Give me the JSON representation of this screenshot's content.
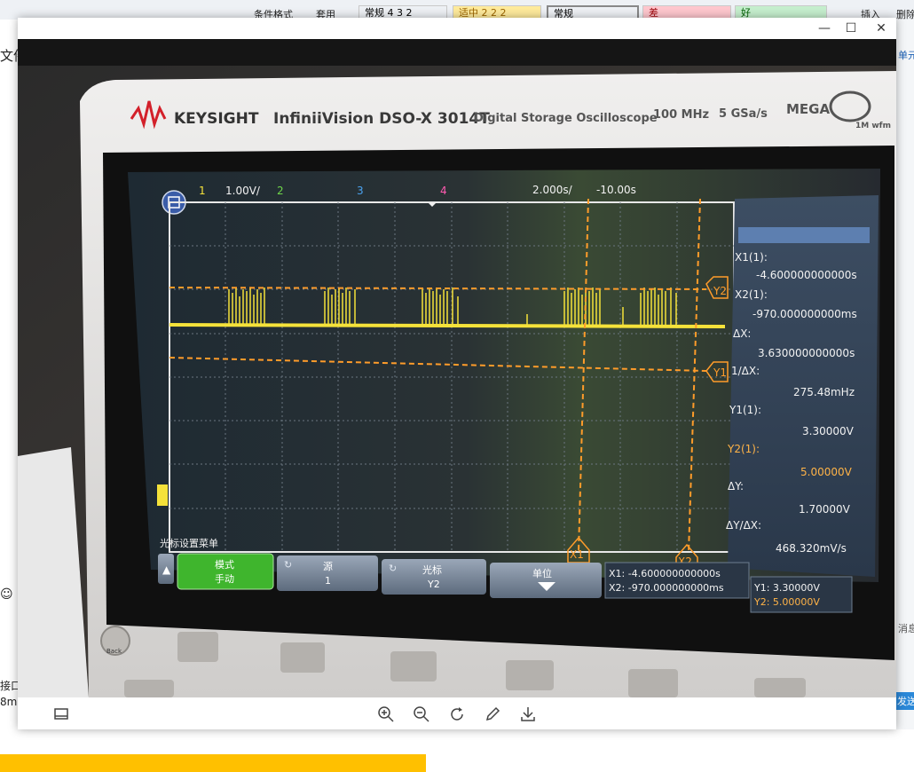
{
  "window": {
    "minimize_label": "—",
    "maximize_label": "☐",
    "close_label": "✕"
  },
  "background_app": {
    "ribbon_text_1": "条件格式",
    "ribbon_text_2": "套用",
    "style_cells": [
      {
        "label": "常规 4 3 2",
        "bg": "#ffffff"
      },
      {
        "label": "适中 2 2 2",
        "bg": "#ffeb9c"
      },
      {
        "label": "常规",
        "bg": "#ffffff"
      },
      {
        "label": "差",
        "bg": "#ffc7ce"
      },
      {
        "label": "好",
        "bg": "#c6efce"
      }
    ],
    "right_text_1": "插入",
    "right_text_2": "删除",
    "right_text_3": "单元",
    "right_msg": "消息",
    "right_send": "发送",
    "left_text_1": "文件",
    "left_text_2": "接口",
    "left_text_3": "8m"
  },
  "scope": {
    "brand": "KEYSIGHT",
    "model": "InfiniiVision DSO-X 3014T",
    "description": "Digital Storage Oscilloscope",
    "bandwidth": "100 MHz",
    "sample_rate": "5 GSa/s",
    "megazoom": "MEGA",
    "megazoom_sub": "1M wfm",
    "ch1_label": "1",
    "ch1_scale": "1.00V/",
    "ch2_label": "2",
    "ch3_label": "3",
    "ch4_label": "4",
    "time_scale": "2.000s/",
    "time_offset": "-10.00s",
    "cursor_labels": {
      "y1": "Y1",
      "y2": "Y2",
      "x1": "X1",
      "x2": "X2"
    },
    "panel": [
      {
        "label": "X1(1):",
        "value": "-4.600000000000s"
      },
      {
        "label": "X2(1):",
        "value": "-970.000000000ms"
      },
      {
        "label": "ΔX:",
        "value": "3.630000000000s"
      },
      {
        "label": "1/ΔX:",
        "value": "275.48mHz"
      },
      {
        "label": "Y1(1):",
        "value": "3.30000V"
      },
      {
        "label": "Y2(1):",
        "value": "5.00000V"
      },
      {
        "label": "ΔY:",
        "value": "1.70000V"
      },
      {
        "label": "ΔY/ΔX:",
        "value": "468.320mV/s"
      }
    ],
    "menu_title": "光标设置菜单",
    "softkeys": [
      {
        "top": "模式",
        "bottom": "手动"
      },
      {
        "top": "源",
        "bottom": "1"
      },
      {
        "top": "光标",
        "bottom": "Y2"
      },
      {
        "top": "单位",
        "bottom": ""
      }
    ],
    "readout_x1": "X1: -4.600000000000s",
    "readout_x2": "X2: -970.000000000ms",
    "readout_y1": "Y1: 3.30000V",
    "readout_y2": "Y2: 5.00000V",
    "back_label": "Back",
    "colors": {
      "ch1": "#f5e23a",
      "cursor": "#ff9c2a",
      "softkey_active": "#3fb52d"
    }
  }
}
